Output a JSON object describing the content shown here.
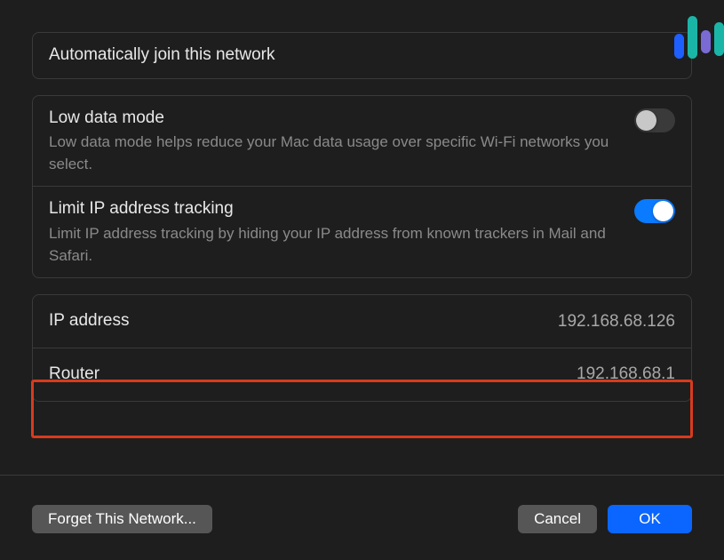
{
  "auto_join": {
    "label": "Automatically join this network"
  },
  "low_data": {
    "title": "Low data mode",
    "desc": "Low data mode helps reduce your Mac data usage over specific Wi-Fi networks you select.",
    "on": false
  },
  "limit_ip": {
    "title": "Limit IP address tracking",
    "desc": "Limit IP address tracking by hiding your IP address from known trackers in Mail and Safari.",
    "on": true
  },
  "ip_address": {
    "label": "IP address",
    "value": "192.168.68.126"
  },
  "router": {
    "label": "Router",
    "value": "192.168.68.1"
  },
  "footer": {
    "forget": "Forget This Network...",
    "cancel": "Cancel",
    "ok": "OK"
  }
}
